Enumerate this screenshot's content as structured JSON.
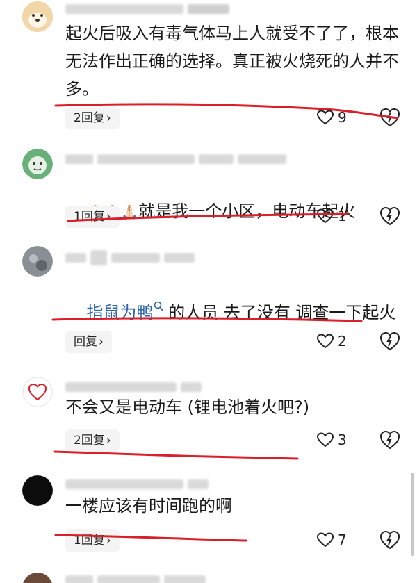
{
  "comments": [
    {
      "text": "起火后吸入有毒气体马上人就受不了了，根本无法作出正确的选择。真正被火烧死的人并不多。",
      "reply_label": "2回复",
      "likes": "9",
      "avatar_icon": "shiba-dog-avatar-icon"
    },
    {
      "emoji": "🙏🏻🙏🏻🙏🏻",
      "text": "就是我一个小区，电动车起火",
      "reply_label": "1回复",
      "likes": "1",
      "avatar_icon": "green-cartoon-avatar-icon"
    },
    {
      "mention": "指鼠为鸭",
      "text": "的人员 去了没有 调查一下起火原因",
      "reply_label": "回复",
      "likes": "2",
      "avatar_icon": "photo-avatar-icon"
    },
    {
      "text": "不会又是电动车 (锂电池着火吧?)",
      "reply_label": "2回复",
      "likes": "3",
      "avatar_icon": "heart-logo-avatar-icon"
    },
    {
      "text": "一楼应该有时间跑的啊",
      "reply_label": "1回复",
      "likes": "7",
      "avatar_icon": "black-avatar-icon"
    }
  ],
  "colors": {
    "accent_link": "#2a62b0",
    "annotation_red": "#d9202a"
  }
}
